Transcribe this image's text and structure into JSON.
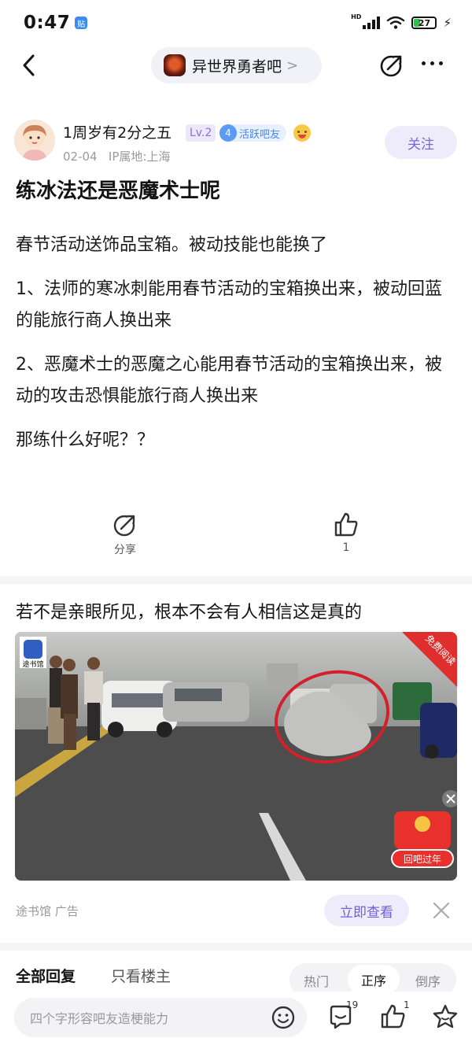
{
  "status_bar": {
    "time": "0:47",
    "badge": "贴",
    "hd": "HD",
    "battery": "27"
  },
  "nav": {
    "forum_name": "异世界勇者吧",
    "chevron": ">"
  },
  "author": {
    "name": "1周岁有2分之五",
    "level": "Lv.2",
    "badge_level": "4",
    "badge_text": "活跃吧友",
    "date": "02-04",
    "ip": "IP属地:上海",
    "follow_label": "关注"
  },
  "post": {
    "title": "练冰法还是恶魔术士呢",
    "paragraphs": [
      "春节活动送饰品宝箱。被动技能也能换了",
      "1、法师的寒冰刺能用春节活动的宝箱换出来，被动回蓝的能旅行商人换出来",
      "2、恶魔术士的恶魔之心能用春节活动的宝箱换出来，被动的攻击恐惧能旅行商人换出来",
      "那练什么好呢？？"
    ]
  },
  "actions": {
    "share_label": "分享",
    "like_count": "1"
  },
  "ad": {
    "title": "若不是亲眼所见，根本不会有人相信这是真的",
    "logo_text": "途书馆",
    "ribbon": "免费阅读",
    "promo_label": "回吧过年",
    "source": "途书馆  广告",
    "view_label": "立即查看"
  },
  "reply_tabs": {
    "all": "全部回复",
    "op_only": "只看楼主",
    "sort_hot": "热门",
    "sort_asc": "正序",
    "sort_desc": "倒序"
  },
  "bottom": {
    "placeholder": "四个字形容吧友造梗能力",
    "comment_count": "19",
    "like_count": "1"
  },
  "colors": {
    "accent": "#7b66d8",
    "ad_circle": "#d3202a",
    "ribbon": "#e02d2d"
  }
}
